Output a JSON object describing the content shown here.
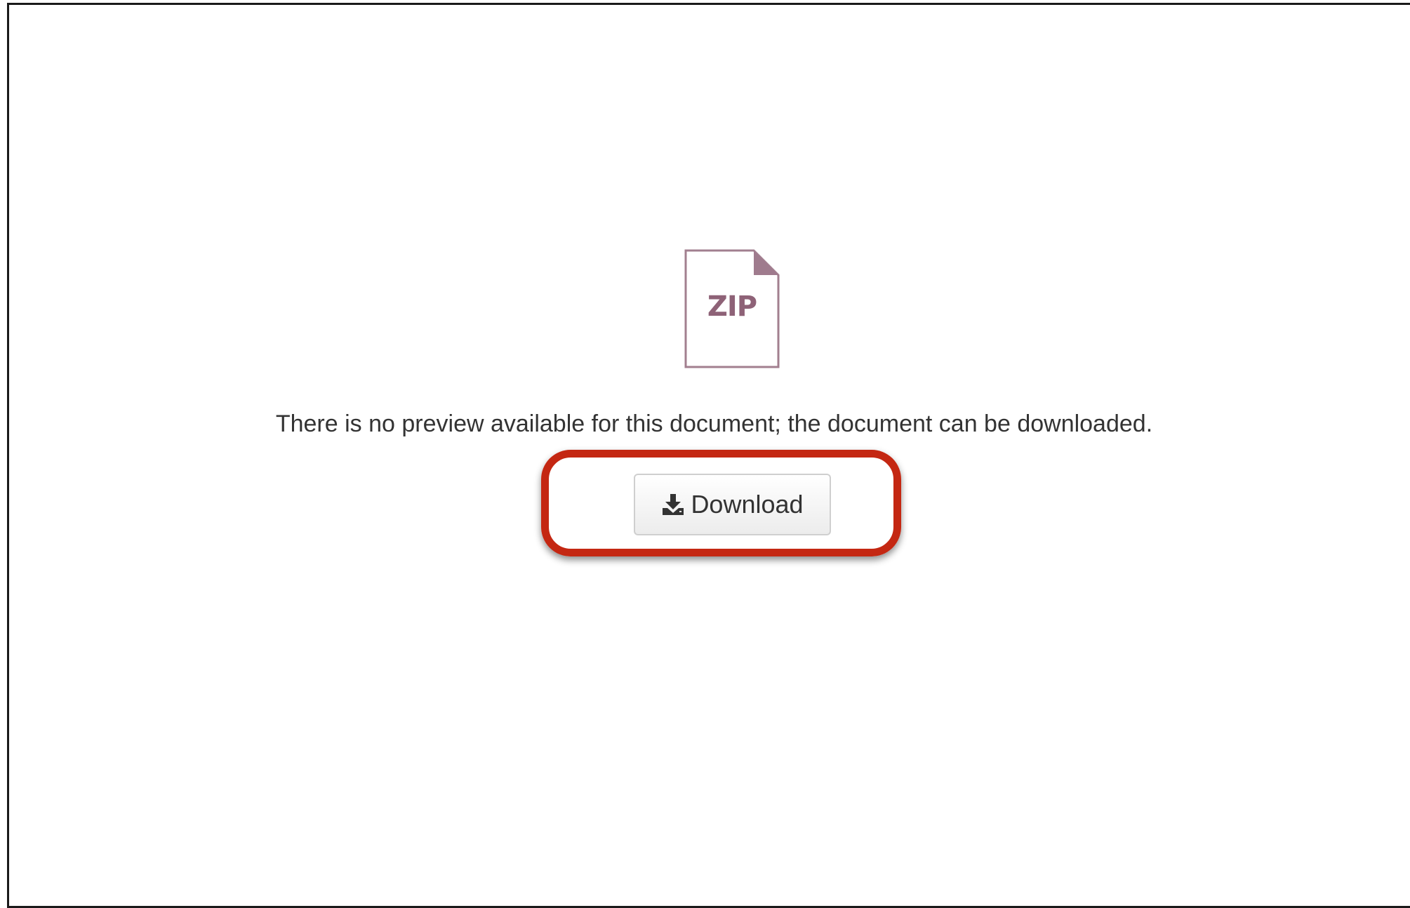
{
  "preview": {
    "file_type": "ZIP",
    "message": "There is no preview available for this document; the document can be downloaded.",
    "icon": "zip-file-icon"
  },
  "download": {
    "label": "Download",
    "icon": "download-icon"
  },
  "colors": {
    "icon": "#8e6277",
    "highlight": "#c42712",
    "text": "#333333"
  }
}
